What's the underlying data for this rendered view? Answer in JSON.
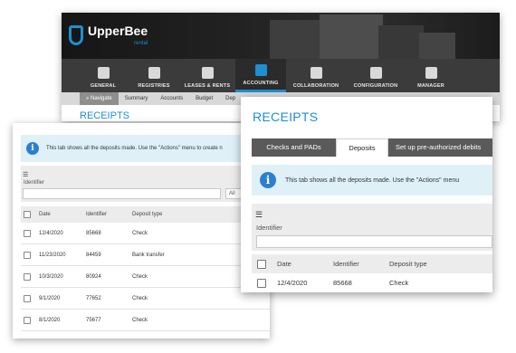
{
  "app": {
    "brand": "UpperBee",
    "brand_sub": "rental"
  },
  "nav": {
    "items": [
      {
        "label": "GENERAL",
        "icon": "document-icon"
      },
      {
        "label": "REGISTRIES",
        "icon": "files-icon"
      },
      {
        "label": "LEASES & RENTS",
        "icon": "cabinet-icon"
      },
      {
        "label": "ACCOUNTING",
        "icon": "calculator-icon",
        "active": true
      },
      {
        "label": "COLLABORATION",
        "icon": "handshake-icon"
      },
      {
        "label": "CONFIGURATION",
        "icon": "gears-icon"
      },
      {
        "label": "MANAGER",
        "icon": "person-icon"
      }
    ],
    "accent_color": "#1e8fd0"
  },
  "subnav": {
    "items": [
      "Navigate",
      "Summary",
      "Accounts",
      "Budget",
      "Dep"
    ]
  },
  "page": {
    "title": "RECEIPTS"
  },
  "tabs": {
    "items": [
      "Checks and PADs",
      "Deposits",
      "Set up pre-authorized debits"
    ],
    "active_index": 1
  },
  "info": {
    "text_back": "This tab shows all the deposits made. Use the \"Actions\" menu to create n",
    "text_front": "This tab shows all the deposits made. Use the \"Actions\" menu"
  },
  "filter": {
    "label": "Identifier",
    "select_value": "All"
  },
  "table": {
    "headers": [
      "Date",
      "Identifier",
      "Deposit type"
    ],
    "rows": [
      {
        "date": "12/4/2020",
        "id": "85668",
        "type": "Check"
      },
      {
        "date": "11/23/2020",
        "id": "84459",
        "type": "Bank transfer"
      },
      {
        "date": "10/3/2020",
        "id": "80924",
        "type": "Check"
      },
      {
        "date": "9/1/2020",
        "id": "77652",
        "type": "Check"
      },
      {
        "date": "8/1/2020",
        "id": "75677",
        "type": "Check"
      }
    ]
  }
}
